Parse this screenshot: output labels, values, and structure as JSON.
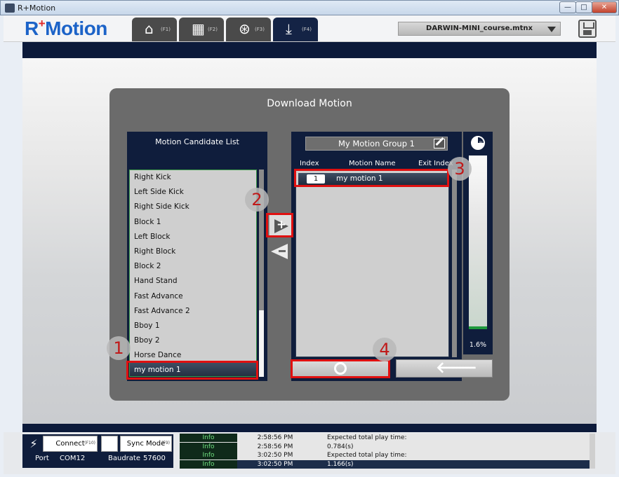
{
  "window": {
    "title": "R+Motion",
    "minimize_label": "—",
    "maximize_label": "□",
    "close_label": "✕"
  },
  "header": {
    "logo_text": "Motion",
    "logo_prefix": "R",
    "logo_plus": "+",
    "tabs": [
      {
        "icon": "home-icon",
        "key": "(F1)"
      },
      {
        "icon": "film-icon",
        "key": "(F2)"
      },
      {
        "icon": "film-reel-icon",
        "key": "(F3)"
      },
      {
        "icon": "download-icon",
        "key": "(F4)"
      }
    ],
    "file_name": "DARWIN-MINI_course.mtnx"
  },
  "dialog": {
    "title": "Download Motion",
    "candidate": {
      "title": "Motion Candidate List",
      "items": [
        "Right Kick",
        "Left Side Kick",
        "Right Side Kick",
        "Block 1",
        "Left Block",
        "Right Block",
        "Block 2",
        "Hand Stand",
        "Fast Advance",
        "Fast Advance 2",
        "Bboy 1",
        "Bboy 2",
        "Horse Dance",
        "my motion 1"
      ],
      "selected_index": 13
    },
    "group": {
      "name": "My Motion Group 1",
      "col_index": "Index",
      "col_name": "Motion Name",
      "col_exit": "Exit Index",
      "rows": [
        {
          "index": "1",
          "name": "my motion 1"
        }
      ]
    },
    "usage": {
      "percent_text": "1.6%",
      "fill_fraction": 0.016
    },
    "markers": [
      "1",
      "2",
      "3",
      "4"
    ]
  },
  "status": {
    "connect_label": "Connect",
    "connect_key": "(F10)",
    "sync_label": "Sync Mode",
    "sync_key": "(F9)",
    "port_label": "Port",
    "port_value": "COM12",
    "baud_label": "Baudrate",
    "baud_value": "57600",
    "log": [
      {
        "level": "Info",
        "time": "2:58:56 PM",
        "msg": "Expected total play time:"
      },
      {
        "level": "Info",
        "time": "2:58:56 PM",
        "msg": "0.784(s)"
      },
      {
        "level": "Info",
        "time": "3:02:50 PM",
        "msg": "Expected total play time:"
      },
      {
        "level": "Info",
        "time": "3:02:50 PM",
        "msg": "1.166(s)"
      }
    ]
  },
  "colors": {
    "navy": "#0f1d3c",
    "dialog": "#6b6b6b",
    "highlight": "#e01010",
    "logo": "#1c63c8"
  }
}
